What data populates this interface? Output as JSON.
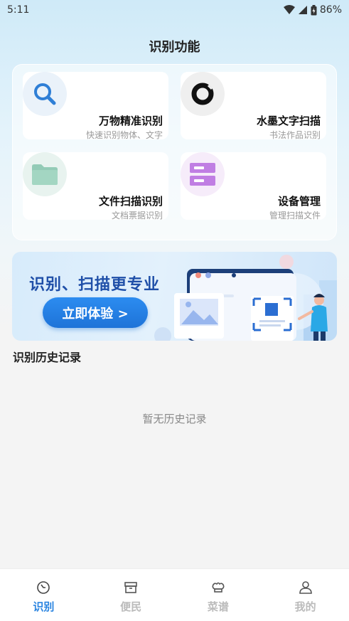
{
  "status_bar": {
    "time": "5:11",
    "battery": "86%"
  },
  "header": {
    "title": "识别功能"
  },
  "features": [
    {
      "title": "万物精准识别",
      "subtitle": "快速识别物体、文字",
      "icon": "search-icon"
    },
    {
      "title": "水墨文字扫描",
      "subtitle": "书法作品识别",
      "icon": "ink-circle-icon"
    },
    {
      "title": "文件扫描识别",
      "subtitle": "文档票据识别",
      "icon": "folder-icon"
    },
    {
      "title": "设备管理",
      "subtitle": "管理扫描文件",
      "icon": "server-icon"
    }
  ],
  "banner": {
    "title": "识别、扫描更专业",
    "button_label": "立即体验 >"
  },
  "history": {
    "title": "识别历史记录",
    "empty_text": "暂无历史记录"
  },
  "tabs": [
    {
      "label": "识别",
      "icon": "compass-icon",
      "active": true
    },
    {
      "label": "便民",
      "icon": "box-icon",
      "active": false
    },
    {
      "label": "菜谱",
      "icon": "chef-hat-icon",
      "active": false
    },
    {
      "label": "我的",
      "icon": "user-icon",
      "active": false
    }
  ],
  "colors": {
    "accent": "#2a84e0",
    "banner_title": "#1f4fa8",
    "inactive_tab": "#bbbbbb"
  }
}
